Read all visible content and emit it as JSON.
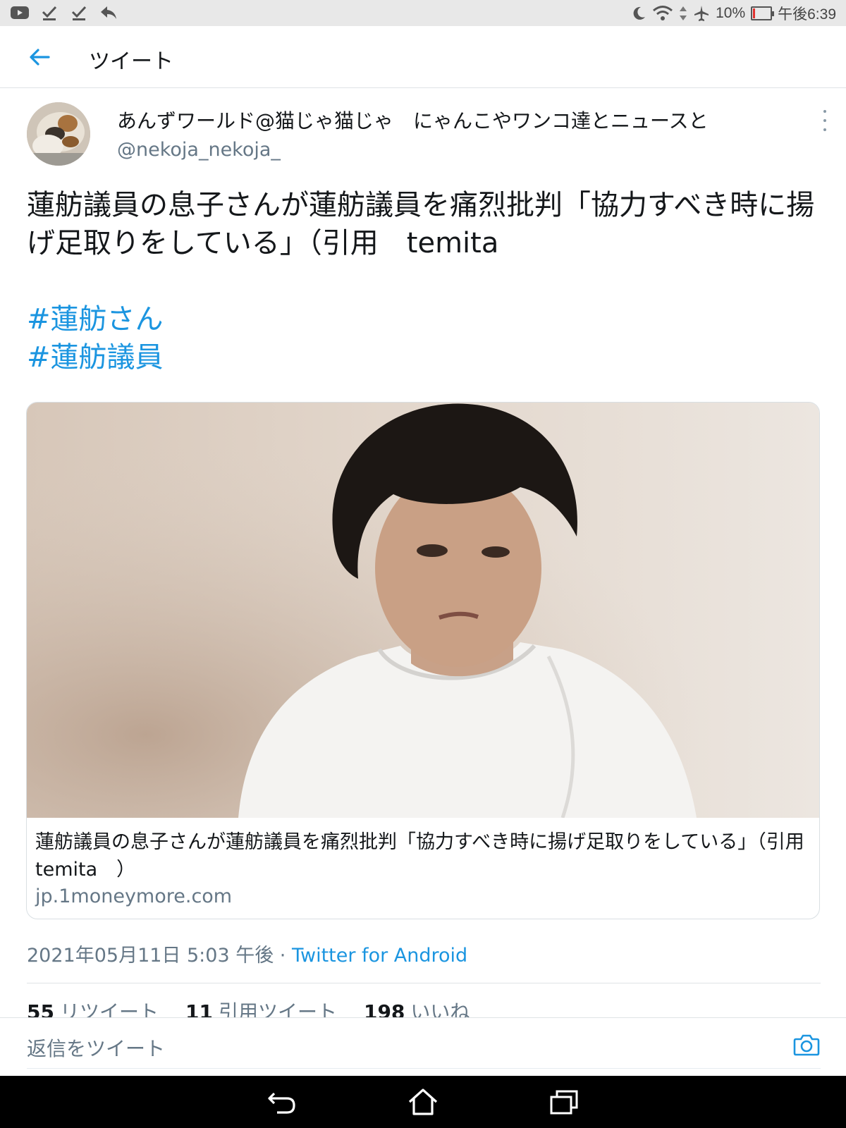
{
  "status_bar": {
    "left_icons": [
      "youtube-icon",
      "check-download-icon",
      "check-download-icon",
      "reply-arrow-icon"
    ],
    "battery": "10%",
    "battery_level": 0.1,
    "time": "午後6:39"
  },
  "header": {
    "title": "ツイート"
  },
  "tweet": {
    "author_name": "あんずワールド@猫じゃ猫じゃ　にゃんこやワンコ達とニュースと",
    "author_handle": "@nekoja_nekoja_",
    "text": "蓮舫議員の息子さんが蓮舫議員を痛烈批判「協力すべき時に揚げ足取りをしている」（引用　temita",
    "hashtags": [
      "#蓮舫さん",
      "#蓮舫議員"
    ],
    "card": {
      "title": "蓮舫議員の息子さんが蓮舫議員を痛烈批判「協力すべき時に揚げ足取りをしている」（引用　temita　）",
      "domain": "jp.1moneymore.com"
    },
    "timestamp": "2021年05月11日 5:03 午後 · ",
    "source": "Twitter for Android",
    "stats": [
      {
        "count": "55",
        "label": "リツイート"
      },
      {
        "count": "11",
        "label": "引用ツイート"
      },
      {
        "count": "198",
        "label": "いいね"
      }
    ]
  },
  "reply": {
    "placeholder": "返信をツイート"
  },
  "colors": {
    "link": "#1b95e0",
    "secondary_text": "#657786",
    "text": "#14171a"
  }
}
